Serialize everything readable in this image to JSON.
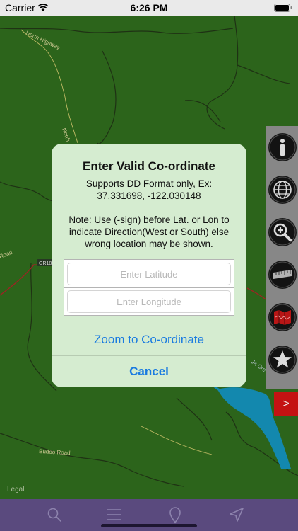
{
  "status_bar": {
    "carrier": "Carrier",
    "time": "6:26 PM"
  },
  "map": {
    "legal": "Legal",
    "labels": {
      "north_highway": "North Highway",
      "north_road": "North",
      "road_left": "Road",
      "road_mid": "GR18",
      "road_right": "Ja Cre",
      "bottom_road": "Budoo Road"
    },
    "colors": {
      "land": "#2f6a1d",
      "water": "#1590b8",
      "river": "#232f18"
    }
  },
  "side_toolbar": {
    "tools": [
      {
        "icon": "info-icon"
      },
      {
        "icon": "globe-icon"
      },
      {
        "icon": "zoom-in-icon"
      },
      {
        "icon": "ruler-icon"
      },
      {
        "icon": "map-layers-icon"
      },
      {
        "icon": "star-icon"
      }
    ],
    "expand_label": ">"
  },
  "dialog": {
    "title": "Enter Valid Co-ordinate",
    "format_line1": "Supports DD Format only, Ex:",
    "format_line2": "37.331698, -122.030148",
    "note_line1": "Note: Use (-sign) before Lat. or Lon to",
    "note_line2": "indicate Direction(West or South) else",
    "note_line3": "wrong location may be shown.",
    "latitude_placeholder": "Enter Latitude",
    "longitude_placeholder": "Enter Longitude",
    "zoom_label": "Zoom to Co-ordinate",
    "cancel_label": "Cancel",
    "accent_color": "#1a7be0"
  },
  "tab_bar": {
    "items": [
      {
        "icon": "search-icon"
      },
      {
        "icon": "menu-icon"
      },
      {
        "icon": "location-pin-icon"
      },
      {
        "icon": "navigation-arrow-icon"
      }
    ],
    "background": "#5a4a7e"
  }
}
